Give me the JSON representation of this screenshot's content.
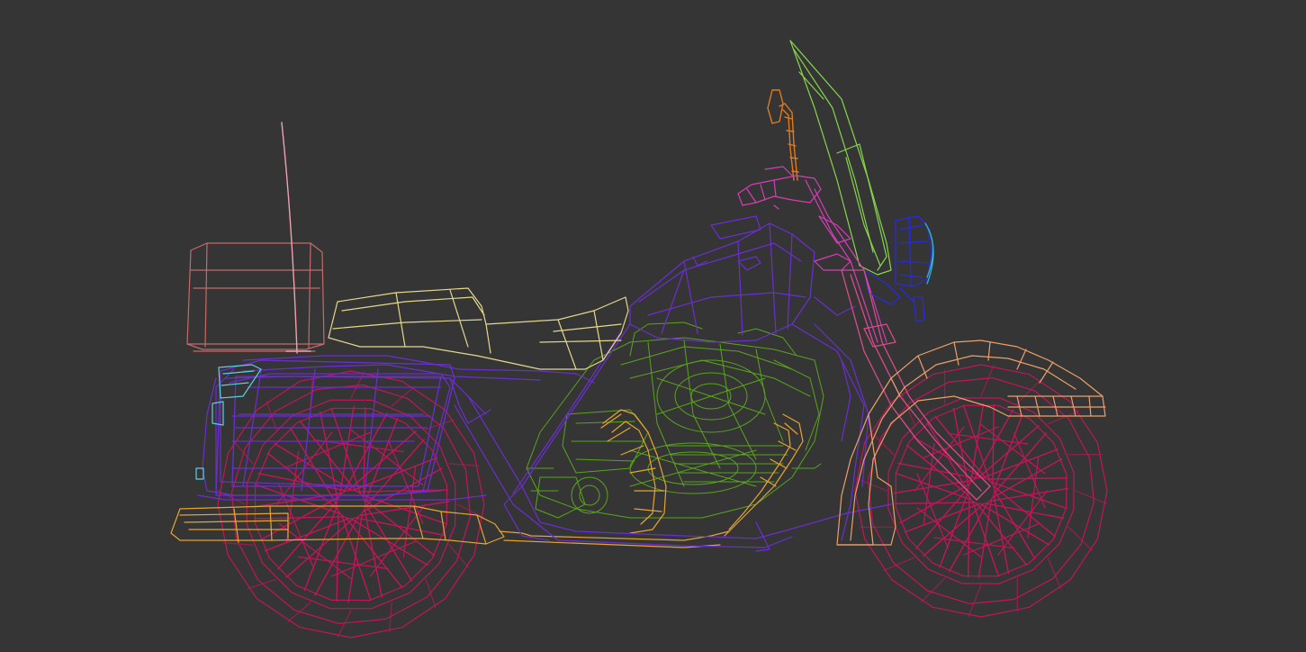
{
  "viewport": {
    "background": "#353535",
    "content": "wireframe-motorcycle-side-view"
  },
  "colors": {
    "wheels": "#c0165a",
    "frame": "#6a2fd0",
    "engine": "#58a51c",
    "exhaust": "#e6a52e",
    "seat": "#e4d98a",
    "top_case": "#c56a6a",
    "antenna": "#f0a0b0",
    "windshield": "#86d64c",
    "mirror": "#e07a1c",
    "handlebar": "#d63db8",
    "headlight": "#2a2ad8",
    "headlight_rim": "#2fb4c8",
    "front_fender": "#eca06a",
    "fork": "#d84c8a",
    "tail_light": "#5ad0e0"
  }
}
